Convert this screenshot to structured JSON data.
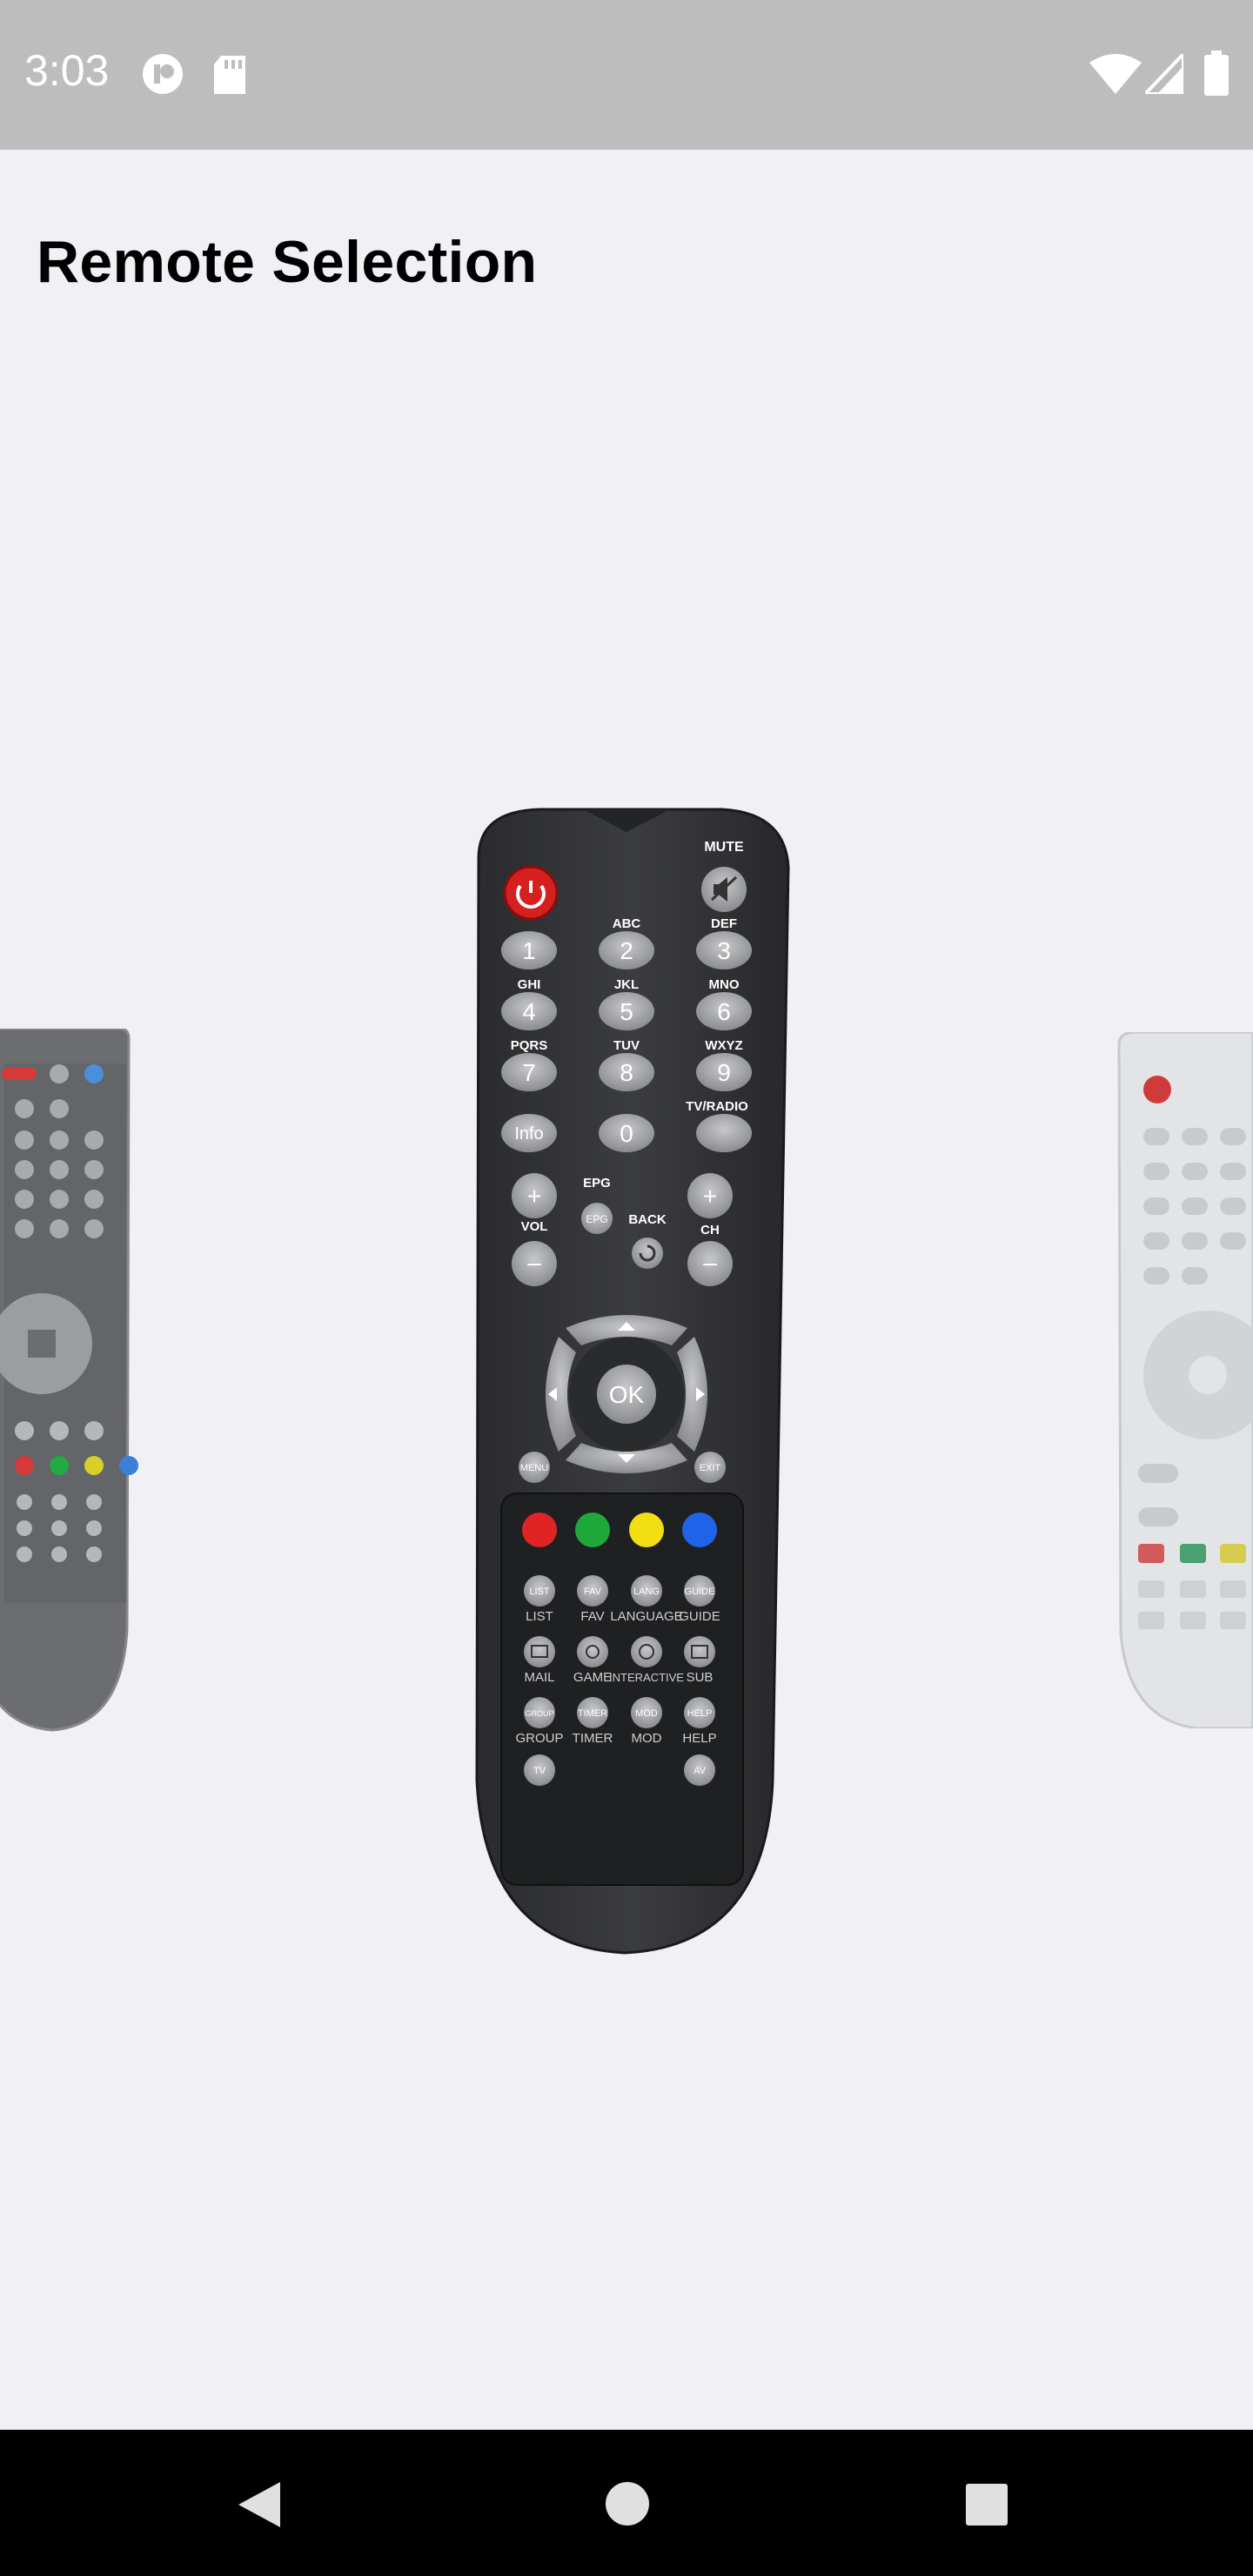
{
  "status_bar": {
    "time": "3:03",
    "icons": [
      "notification-app-icon",
      "sd-card-icon",
      "wifi-icon",
      "cell-signal-icon",
      "battery-icon"
    ]
  },
  "header": {
    "title": "Remote Selection"
  },
  "carousel": {
    "remotes": [
      {
        "name": "dark-gray-remote-partial-left"
      },
      {
        "name": "black-remote-center"
      },
      {
        "name": "white-remote-partial-right"
      }
    ],
    "center_remote_labels": {
      "mute": "MUTE",
      "abc": "ABC",
      "def": "DEF",
      "ghi": "GHI",
      "jkl": "JKL",
      "mno": "MNO",
      "pqrs": "PQRS",
      "tuv": "TUV",
      "wxyz": "WXYZ",
      "tv_radio": "TV/RADIO",
      "info": "Info",
      "epg": "EPG",
      "back": "BACK",
      "vol": "VOL",
      "ch": "CH",
      "ok": "OK",
      "menu": "MENU",
      "exit": "EXIT",
      "list": "LIST",
      "fav": "FAV",
      "lang": "LANG",
      "guide": "GUIDE",
      "language": "LANGUAGE",
      "mail": "MAIL",
      "game": "GAME",
      "interactive": "INTERACTIVE",
      "sub": "SUB",
      "group": "GROUP",
      "timer": "TIMER",
      "mod": "MOD",
      "help": "HELP",
      "tv": "TV",
      "av": "AV",
      "digits": [
        "1",
        "2",
        "3",
        "4",
        "5",
        "6",
        "7",
        "8",
        "9",
        "0"
      ]
    },
    "colors": {
      "red": "#e02424",
      "green": "#1fa83a",
      "yellow": "#f2de12",
      "blue": "#1e63e8"
    }
  },
  "nav_bar": {
    "icons": [
      "back-icon",
      "home-icon",
      "recents-icon"
    ]
  }
}
